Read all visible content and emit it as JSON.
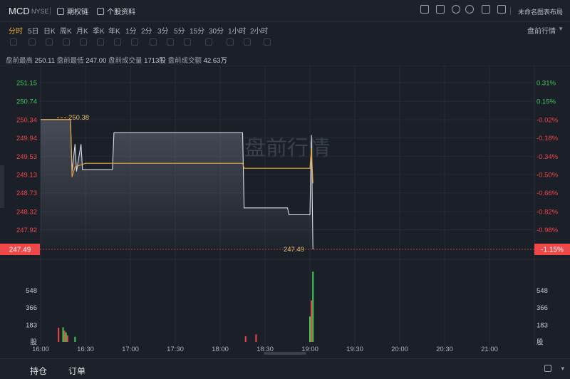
{
  "header": {
    "ticker": "MCD",
    "exchange": "NYSE",
    "options_chain_label": "期权链",
    "stock_profile_label": "个股资料",
    "layout_label": "未命名图表布局"
  },
  "timeframes": {
    "items": [
      "分时",
      "5日",
      "日K",
      "周K",
      "月K",
      "季K",
      "年K",
      "1分",
      "2分",
      "3分",
      "5分",
      "15分",
      "30分",
      "1小时",
      "2小时"
    ],
    "active": "分时",
    "session_label": "盘前行情"
  },
  "stats": {
    "high_label": "盘前最高",
    "high_value": "250.11",
    "low_label": "盘前最低",
    "low_value": "247.00",
    "volume_label": "盘前成交量",
    "volume_value": "1713股",
    "turnover_label": "盘前成交额",
    "turnover_value": "42.63万"
  },
  "watermark": "盘前行情",
  "colors": {
    "up": "#3dcc58",
    "down": "#f04848",
    "avg": "#e8a33c",
    "accent": "#e8b23a"
  },
  "chart_data": {
    "type": "line",
    "price_ticks": [
      "251.15",
      "250.74",
      "250.34",
      "249.94",
      "249.53",
      "249.13",
      "248.73",
      "248.32",
      "247.92"
    ],
    "percent_ticks": [
      "0.31%",
      "0.15%",
      "-0.02%",
      "-0.18%",
      "-0.34%",
      "-0.50%",
      "-0.66%",
      "-0.82%",
      "-0.98%"
    ],
    "ylim": [
      247.49,
      251.15
    ],
    "prev_close": 250.38,
    "prev_close_label": "250.38",
    "current_price": "247.49",
    "current_percent": "-1.15%",
    "x_ticks": [
      "16:00",
      "16:30",
      "17:00",
      "17:30",
      "18:00",
      "18:30",
      "19:00",
      "19:30",
      "20:00",
      "20:30",
      "21:00"
    ],
    "x_range": [
      "16:00",
      "21:30"
    ],
    "series": [
      {
        "x": [
          "16:00",
          "16:20",
          "16:21",
          "16:23",
          "16:24",
          "16:27",
          "16:28",
          "16:30",
          "16:37",
          "16:48",
          "16:49",
          "18:15",
          "18:16",
          "18:45",
          "18:46",
          "19:00",
          "19:01",
          "19:02"
        ],
        "values": [
          250.34,
          250.34,
          249.2,
          249.8,
          249.2,
          249.8,
          249.24,
          249.24,
          249.24,
          249.24,
          250.05,
          250.05,
          248.4,
          248.4,
          248.25,
          248.25,
          250.0,
          247.49
        ]
      },
      {
        "x": [
          "16:00",
          "16:20",
          "16:21",
          "16:23",
          "16:30",
          "17:00",
          "17:30",
          "18:00",
          "18:15",
          "18:16",
          "18:45",
          "19:00",
          "19:01",
          "19:02"
        ],
        "values": [
          250.34,
          250.34,
          249.08,
          249.3,
          249.38,
          249.38,
          249.38,
          249.38,
          249.38,
          249.27,
          249.27,
          249.27,
          249.7,
          248.94
        ]
      }
    ],
    "volume_ticks": [
      "548",
      "366",
      "183",
      "股"
    ],
    "volume_ylim": [
      0,
      800
    ],
    "volumes": [
      {
        "x": "16:12",
        "v": 150,
        "dir": "down"
      },
      {
        "x": "16:15",
        "v": 155,
        "dir": "up"
      },
      {
        "x": "16:16",
        "v": 120,
        "dir": "down"
      },
      {
        "x": "16:17",
        "v": 100,
        "dir": "up"
      },
      {
        "x": "16:18",
        "v": 70,
        "dir": "down"
      },
      {
        "x": "16:23",
        "v": 55,
        "dir": "up"
      },
      {
        "x": "18:17",
        "v": 60,
        "dir": "down"
      },
      {
        "x": "18:24",
        "v": 80,
        "dir": "down"
      },
      {
        "x": "19:00",
        "v": 270,
        "dir": "up"
      },
      {
        "x": "19:01",
        "v": 440,
        "dir": "down"
      },
      {
        "x": "19:02",
        "v": 745,
        "dir": "up"
      }
    ]
  },
  "bottom": {
    "tab1": "持仓",
    "tab2": "订单"
  }
}
